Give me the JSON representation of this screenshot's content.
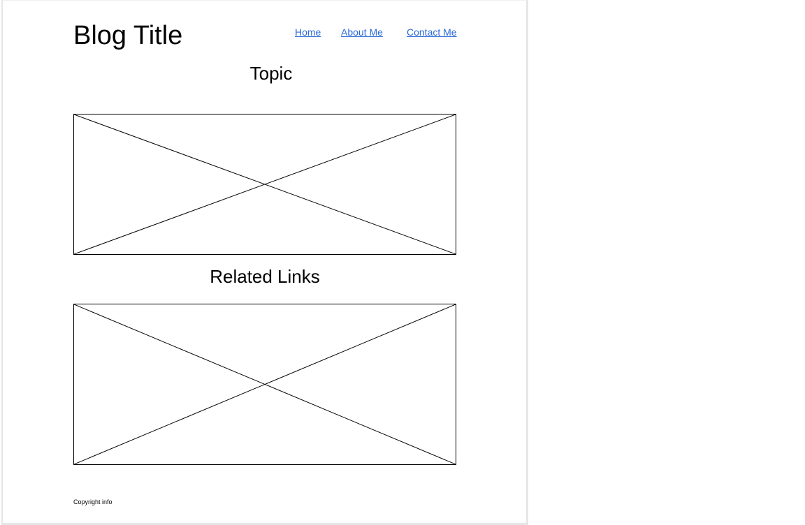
{
  "header": {
    "blog_title": "Blog Title"
  },
  "nav": {
    "home": "Home",
    "about": "About Me",
    "contact": "Contact Me"
  },
  "main": {
    "topic_heading": "Topic",
    "related_heading": "Related Links"
  },
  "footer": {
    "copyright": "Copyright info"
  },
  "colors": {
    "link": "#2a6ad8",
    "text": "#000000",
    "frame": "#e6e6e6"
  }
}
